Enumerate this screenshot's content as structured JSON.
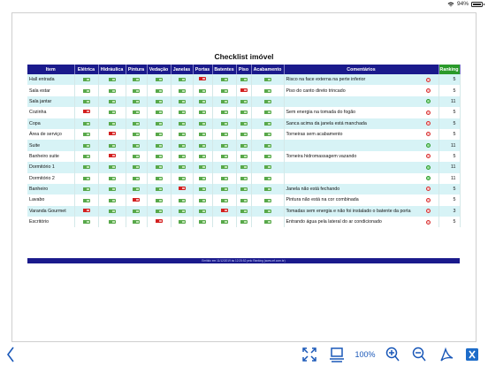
{
  "status": {
    "battery": "94%"
  },
  "title": "Checklist imóvel",
  "headers": [
    "Item",
    "Elétrica",
    "Hidráulica",
    "Pintura",
    "Vedação",
    "Janelas",
    "Portas",
    "Batentes",
    "Piso",
    "Acabamento",
    "Comentários",
    "Ranking"
  ],
  "rows": [
    {
      "item": "Hall entrada",
      "marks": [
        "up",
        "up",
        "up",
        "up",
        "up",
        "down",
        "up",
        "up",
        "up"
      ],
      "comment": "Risco na face externa na perte inferior",
      "status": "bad",
      "rank": "5"
    },
    {
      "item": "Sala estar",
      "marks": [
        "up",
        "up",
        "up",
        "up",
        "up",
        "up",
        "up",
        "down",
        "up"
      ],
      "comment": "Piso do canto direto trincado",
      "status": "bad",
      "rank": "5"
    },
    {
      "item": "Sala jantar",
      "marks": [
        "up",
        "up",
        "up",
        "up",
        "up",
        "up",
        "up",
        "up",
        "up"
      ],
      "comment": "",
      "status": "good",
      "rank": "11"
    },
    {
      "item": "Cozinha",
      "marks": [
        "down",
        "up",
        "up",
        "up",
        "up",
        "up",
        "up",
        "up",
        "up"
      ],
      "comment": "Sem energia na tomada do fogão",
      "status": "bad",
      "rank": "5"
    },
    {
      "item": "Copa",
      "marks": [
        "up",
        "up",
        "up",
        "up",
        "up",
        "up",
        "up",
        "up",
        "up"
      ],
      "comment": "Sanca acima da janela está manchada",
      "status": "bad",
      "rank": "5"
    },
    {
      "item": "Área de serviço",
      "marks": [
        "up",
        "down",
        "up",
        "up",
        "up",
        "up",
        "up",
        "up",
        "up"
      ],
      "comment": "Torneiras sem acabamento",
      "status": "bad",
      "rank": "5"
    },
    {
      "item": "Suite",
      "marks": [
        "up",
        "up",
        "up",
        "up",
        "up",
        "up",
        "up",
        "up",
        "up"
      ],
      "comment": "",
      "status": "good",
      "rank": "11"
    },
    {
      "item": "Banheiro suite",
      "marks": [
        "up",
        "down",
        "up",
        "up",
        "up",
        "up",
        "up",
        "up",
        "up"
      ],
      "comment": "Torneira hidromassagem vazando",
      "status": "bad",
      "rank": "5"
    },
    {
      "item": "Dormitório 1",
      "marks": [
        "up",
        "up",
        "up",
        "up",
        "up",
        "up",
        "up",
        "up",
        "up"
      ],
      "comment": "",
      "status": "good",
      "rank": "11"
    },
    {
      "item": "Dormitório 2",
      "marks": [
        "up",
        "up",
        "up",
        "up",
        "up",
        "up",
        "up",
        "up",
        "up"
      ],
      "comment": "",
      "status": "good",
      "rank": "11"
    },
    {
      "item": "Banheiro",
      "marks": [
        "up",
        "up",
        "up",
        "up",
        "down",
        "up",
        "up",
        "up",
        "up"
      ],
      "comment": "Janela não está fechando",
      "status": "bad",
      "rank": "5"
    },
    {
      "item": "Lavabo",
      "marks": [
        "up",
        "up",
        "down",
        "up",
        "up",
        "up",
        "up",
        "up",
        "up"
      ],
      "comment": "Pintura não está na cor combinada",
      "status": "bad",
      "rank": "5"
    },
    {
      "item": "Varanda Gourmet",
      "marks": [
        "down",
        "up",
        "up",
        "up",
        "up",
        "up",
        "down",
        "up",
        "up"
      ],
      "comment": "Tomadas sem energia e não foi instalado o batente da porta",
      "status": "bad",
      "rank": "3"
    },
    {
      "item": "Escritório",
      "marks": [
        "up",
        "up",
        "up",
        "down",
        "up",
        "up",
        "up",
        "up",
        "up"
      ],
      "comment": "Entrando água pela lateral do ar condicionado",
      "status": "bad",
      "rank": "5"
    }
  ],
  "footer": "Emitido em 11/12/2019 às 12:25:52 pelo Ranking (www.xrf.com.br)",
  "toolbar": {
    "zoom": "100%"
  },
  "colors": {
    "header": "#1a1a8c",
    "ranking": "#2a9a2a",
    "alt_row": "#d7f3f6",
    "accent": "#1a58b8"
  }
}
